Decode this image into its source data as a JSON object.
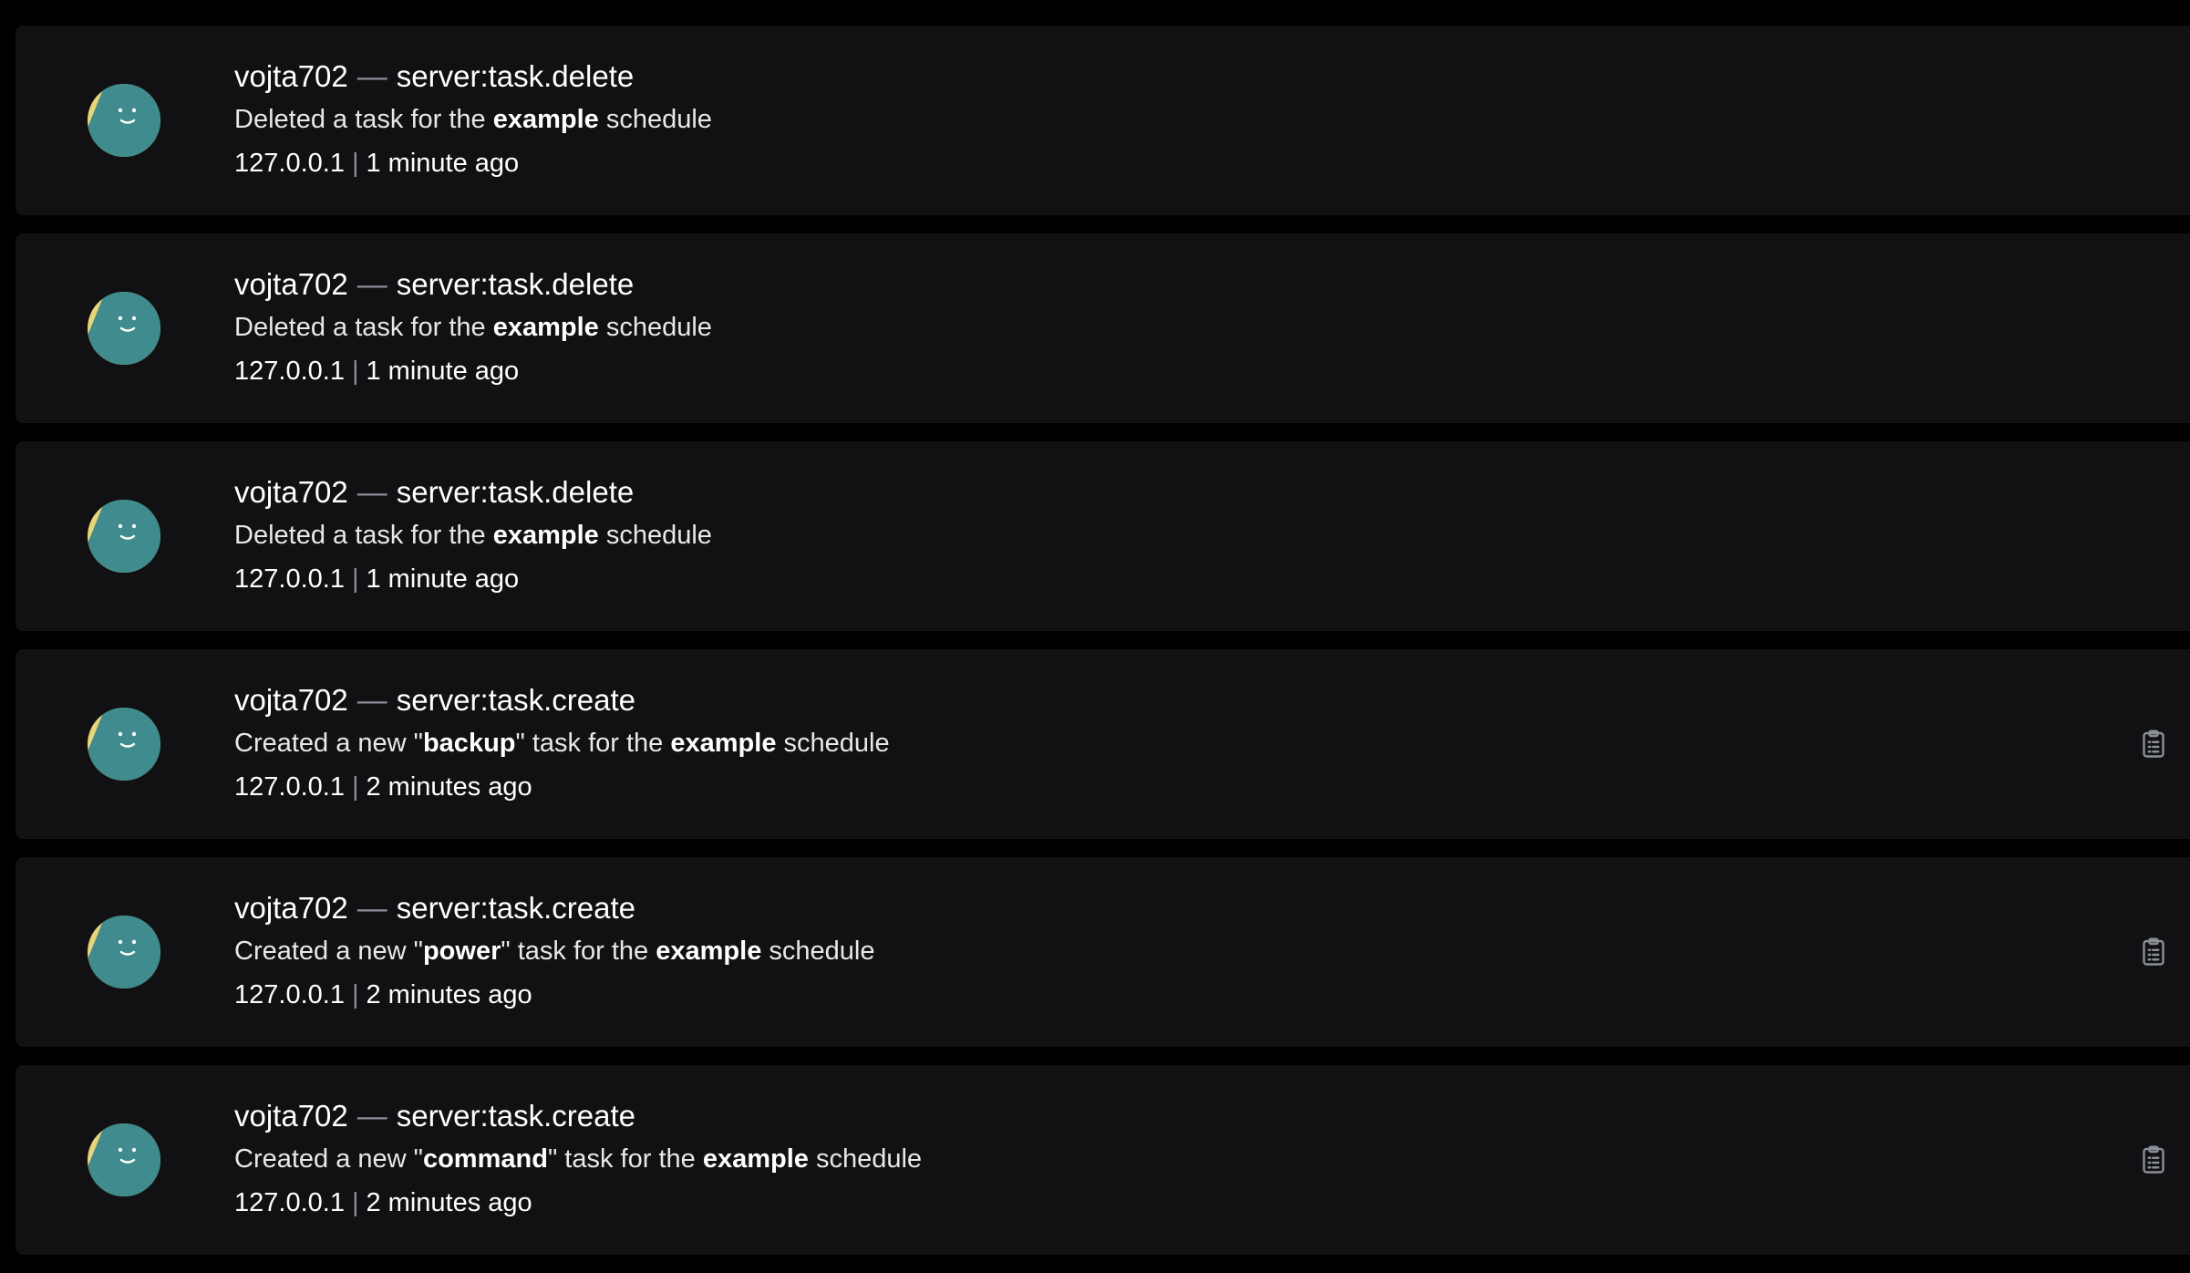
{
  "colors": {
    "background": "#000000",
    "row": "#111113",
    "avatar_teal": "#3f8b8d",
    "avatar_yellow": "#e8d579",
    "muted": "#8a8f98"
  },
  "entries": [
    {
      "user": "vojta702",
      "dash": "—",
      "event": "server:task.delete",
      "desc": {
        "pre": "Deleted a task for the ",
        "b1": "example",
        "mid": " schedule",
        "b2": "",
        "post": ""
      },
      "ip": "127.0.0.1",
      "sep": "|",
      "time": "1 minute ago",
      "has_metadata": false
    },
    {
      "user": "vojta702",
      "dash": "—",
      "event": "server:task.delete",
      "desc": {
        "pre": "Deleted a task for the ",
        "b1": "example",
        "mid": " schedule",
        "b2": "",
        "post": ""
      },
      "ip": "127.0.0.1",
      "sep": "|",
      "time": "1 minute ago",
      "has_metadata": false
    },
    {
      "user": "vojta702",
      "dash": "—",
      "event": "server:task.delete",
      "desc": {
        "pre": "Deleted a task for the ",
        "b1": "example",
        "mid": " schedule",
        "b2": "",
        "post": ""
      },
      "ip": "127.0.0.1",
      "sep": "|",
      "time": "1 minute ago",
      "has_metadata": false
    },
    {
      "user": "vojta702",
      "dash": "—",
      "event": "server:task.create",
      "desc": {
        "pre": "Created a new \"",
        "b1": "backup",
        "mid": "\" task for the ",
        "b2": "example",
        "post": " schedule"
      },
      "ip": "127.0.0.1",
      "sep": "|",
      "time": "2 minutes ago",
      "has_metadata": true
    },
    {
      "user": "vojta702",
      "dash": "—",
      "event": "server:task.create",
      "desc": {
        "pre": "Created a new \"",
        "b1": "power",
        "mid": "\" task for the ",
        "b2": "example",
        "post": " schedule"
      },
      "ip": "127.0.0.1",
      "sep": "|",
      "time": "2 minutes ago",
      "has_metadata": true
    },
    {
      "user": "vojta702",
      "dash": "—",
      "event": "server:task.create",
      "desc": {
        "pre": "Created a new \"",
        "b1": "command",
        "mid": "\" task for the ",
        "b2": "example",
        "post": " schedule"
      },
      "ip": "127.0.0.1",
      "sep": "|",
      "time": "2 minutes ago",
      "has_metadata": true,
      "icon": "clipboard-list-icon"
    }
  ]
}
